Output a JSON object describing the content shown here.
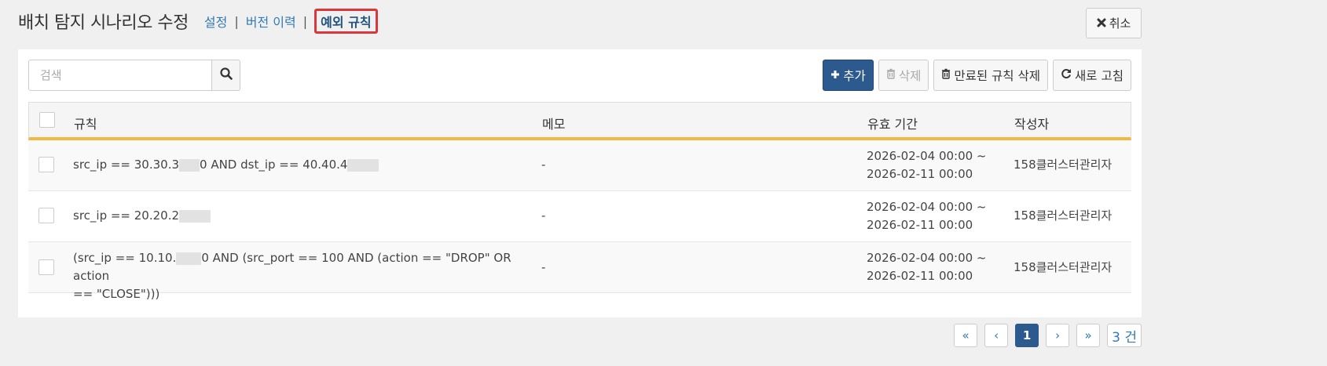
{
  "header": {
    "title": "배치 탐지 시나리오 수정",
    "tabs": [
      {
        "label": "설정"
      },
      {
        "label": "버전 이력"
      },
      {
        "label": "예외 규칙"
      }
    ],
    "separator": "|",
    "cancel_label": "취소"
  },
  "search": {
    "placeholder": "검색"
  },
  "toolbar": {
    "add_label": "추가",
    "delete_label": "삭제",
    "delete_expired_label": "만료된 규칙 삭제",
    "refresh_label": "새로 고침"
  },
  "table": {
    "columns": {
      "rule": "규칙",
      "memo": "메모",
      "period": "유효 기간",
      "author": "작성자"
    },
    "rows": [
      {
        "rule_a": "src_ip == 30.30.3",
        "rule_b": "0 AND dst_ip == 40.40.4",
        "rule_c": "",
        "memo": "-",
        "period_start": "2026-02-04 00:00 ~",
        "period_end": "2026-02-11 00:00",
        "author": "158클러스터관리자"
      },
      {
        "rule_a": "src_ip == 20.20.2",
        "rule_b": "",
        "rule_c": "",
        "memo": "-",
        "period_start": "2026-02-04 00:00 ~",
        "period_end": "2026-02-11 00:00",
        "author": "158클러스터관리자"
      },
      {
        "rule_a": "(src_ip == 10.10.",
        "rule_b": "0 AND (src_port == 100 AND (action == \"DROP\" OR action",
        "rule_c": "== \"CLOSE\")))",
        "memo": "-",
        "period_start": "2026-02-04 00:00 ~",
        "period_end": "2026-02-11 00:00",
        "author": "158클러스터관리자"
      }
    ]
  },
  "pagination": {
    "first": "«",
    "prev": "‹",
    "current_page": "1",
    "next": "›",
    "last": "»",
    "count_text": "3 건"
  },
  "colors": {
    "primary": "#2c5a8e",
    "link": "#337ab7",
    "active_tab_border": "#d9363e",
    "table_header_underline": "#f0b942"
  }
}
